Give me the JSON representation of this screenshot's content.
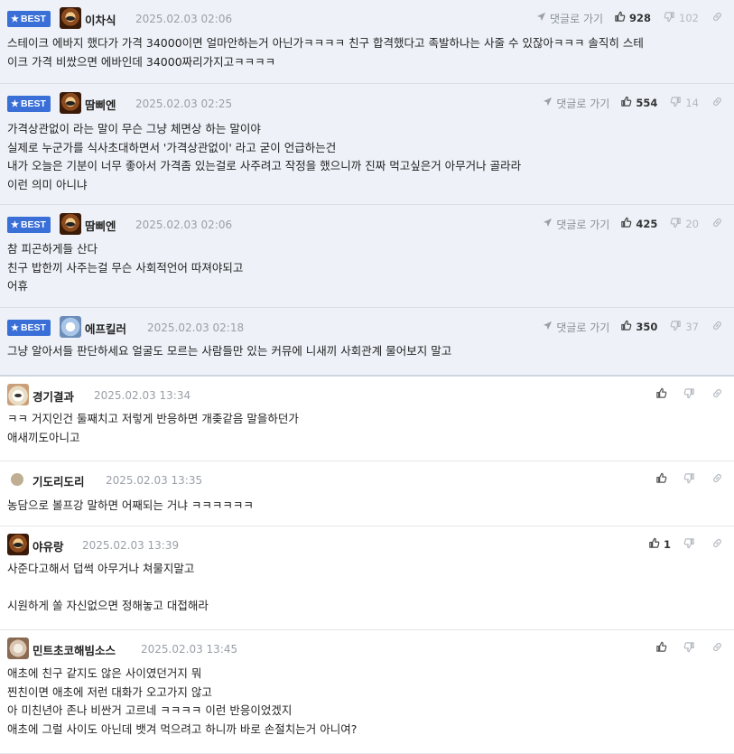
{
  "best_badge": "BEST",
  "reply_label": "댓글로 가기",
  "comments": [
    {
      "best": true,
      "avatar": "dog",
      "nick": "이차식",
      "time": "2025.02.03 02:06",
      "up": "928",
      "down": "102",
      "body": "스테이크 에바지 했다가 가격 34000이면 얼마안하는거 아닌가ㅋㅋㅋㅋ 친구 합격했다고 족발하나는 사줄 수 있잖아ㅋㅋㅋ 솔직히 스테\n이크 가격 비쌌으면 에바인데 34000짜리가지고ㅋㅋㅋㅋ"
    },
    {
      "best": true,
      "avatar": "dog",
      "nick": "땀삐엔",
      "time": "2025.02.03 02:25",
      "up": "554",
      "down": "14",
      "body": "가격상관없이 라는 말이 무슨 그냥 체면상 하는 말이야\n실제로 누군가를 식사초대하면서 '가격상관없이' 라고 굳이 언급하는건\n내가 오늘은 기분이 너무 좋아서 가격좀 있는걸로 사주려고 작정을 했으니까 진짜 먹고싶은거 아무거나 골라라\n이런 의미 아니냐"
    },
    {
      "best": true,
      "avatar": "dog",
      "nick": "땀삐엔",
      "time": "2025.02.03 02:06",
      "up": "425",
      "down": "20",
      "body": "참 피곤하게들 산다\n친구 밥한끼 사주는걸 무슨 사회적언어 따져야되고\n어휴"
    },
    {
      "best": true,
      "avatar": "blue",
      "nick": "에프킬러",
      "time": "2025.02.03 02:18",
      "up": "350",
      "down": "37",
      "body": "그냥 알아서들 판단하세요 얼굴도 모르는 사람들만 있는 커뮤에 니새끼 사회관계 물어보지 말고"
    },
    {
      "best": false,
      "avatar": "dog2",
      "nick": "경기결과",
      "time": "2025.02.03 13:34",
      "up": "",
      "down": "",
      "body": "ㅋㅋ 거지인건 둘째치고 저렇게 반응하면 개좆같음 말을하던가\n애새끼도아니고"
    },
    {
      "best": false,
      "avatar": "dot",
      "nick": "기도리도리",
      "time": "2025.02.03 13:35",
      "up": "",
      "down": "",
      "body": "농담으로 볼프강 말하면 어째되는 거냐 ㅋㅋㅋㅋㅋㅋ"
    },
    {
      "best": false,
      "avatar": "dog",
      "nick": "야유랑",
      "time": "2025.02.03 13:39",
      "up": "1",
      "down": "",
      "body": "사준다고해서 덥썩 아무거나 쳐물지말고\n\n시원하게 쏠 자신없으면 정해놓고 대접해라"
    },
    {
      "best": false,
      "avatar": "bear",
      "nick": "민트초코해빔소스",
      "time": "2025.02.03 13:45",
      "up": "",
      "down": "",
      "body": "애초에 친구 같지도 않은 사이였던거지 뭐\n찐친이면 애초에 저런 대화가 오고가지 않고\n아 미친년아 존나 비싼거 고르네 ㅋㅋㅋㅋ 이런 반응이었겠지\n애초에 그럴 사이도 아닌데 뱃겨 먹으려고 하니까 바로 손절치는거 아니여?"
    }
  ]
}
